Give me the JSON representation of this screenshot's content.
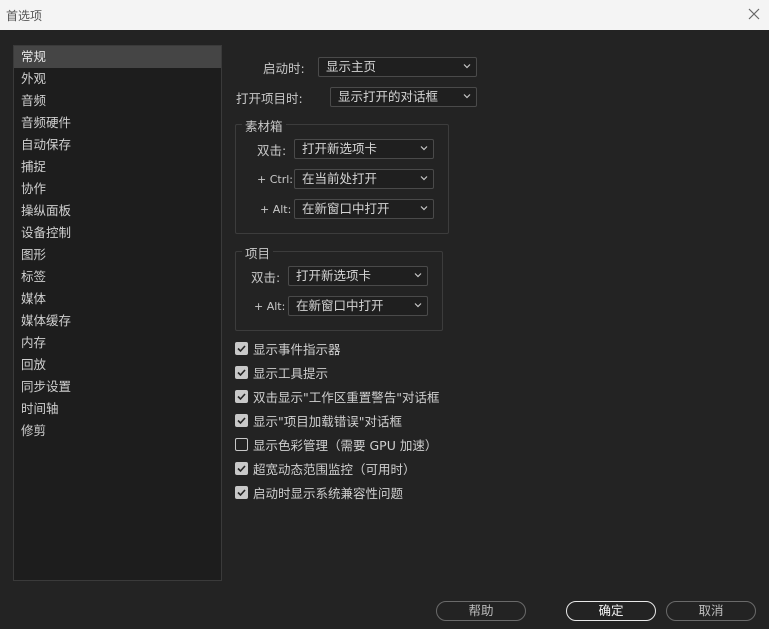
{
  "window": {
    "title": "首选项"
  },
  "sidebar": {
    "items": [
      {
        "label": "常规",
        "active": true
      },
      {
        "label": "外观"
      },
      {
        "label": "音频"
      },
      {
        "label": "音频硬件"
      },
      {
        "label": "自动保存"
      },
      {
        "label": "捕捉"
      },
      {
        "label": "协作"
      },
      {
        "label": "操纵面板"
      },
      {
        "label": "设备控制"
      },
      {
        "label": "图形"
      },
      {
        "label": "标签"
      },
      {
        "label": "媒体"
      },
      {
        "label": "媒体缓存"
      },
      {
        "label": "内存"
      },
      {
        "label": "回放"
      },
      {
        "label": "同步设置"
      },
      {
        "label": "时间轴"
      },
      {
        "label": "修剪"
      }
    ]
  },
  "general": {
    "startup_label": "启动时:",
    "startup_value": "显示主页",
    "open_project_label": "打开项目时:",
    "open_project_value": "显示打开的对话框"
  },
  "bins": {
    "title": "素材箱",
    "double_click_label": "双击:",
    "double_click_value": "打开新选项卡",
    "ctrl_label": "+ Ctrl:",
    "ctrl_value": "在当前处打开",
    "alt_label": "+ Alt:",
    "alt_value": "在新窗口中打开"
  },
  "project": {
    "title": "项目",
    "double_click_label": "双击:",
    "double_click_value": "打开新选项卡",
    "alt_label": "+ Alt:",
    "alt_value": "在新窗口中打开"
  },
  "checkboxes": [
    {
      "label": "显示事件指示器",
      "checked": true
    },
    {
      "label": "显示工具提示",
      "checked": true
    },
    {
      "label": "双击显示\"工作区重置警告\"对话框",
      "checked": true
    },
    {
      "label": "显示\"项目加载错误\"对话框",
      "checked": true
    },
    {
      "label": "显示色彩管理（需要 GPU 加速）",
      "checked": false
    },
    {
      "label": "超宽动态范围监控（可用时）",
      "checked": true
    },
    {
      "label": "启动时显示系统兼容性问题",
      "checked": true
    }
  ],
  "footer": {
    "help_label": "帮助",
    "ok_label": "确定",
    "cancel_label": "取消"
  },
  "colors": {
    "background": "#232323",
    "panel": "#1d1d1d",
    "selected": "#454545",
    "text": "#c8c8c8"
  }
}
